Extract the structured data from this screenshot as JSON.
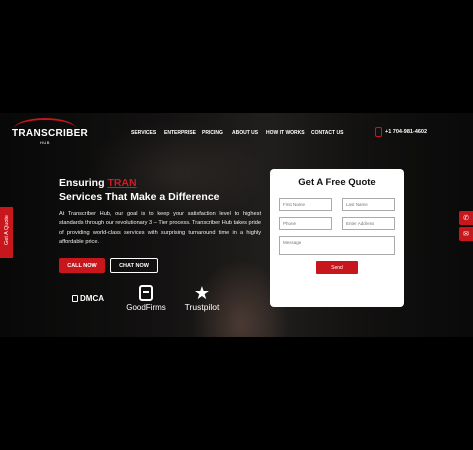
{
  "brand": {
    "name": "TRANSCRIBER",
    "sub": "HUB"
  },
  "nav": {
    "items": [
      "SERVICES",
      "ENTERPRISE",
      "PRICING",
      "ABOUT US",
      "HOW IT WORKS",
      "CONTACT US"
    ],
    "phone": "+1 704-981-4602"
  },
  "hero": {
    "title_prefix": "Ensuring",
    "title_accent": "TRAN",
    "title_line2": "Services That Make a Difference",
    "paragraph": "At Transcriber Hub, our goal is to keep your satisfaction level to highest standards through our revolutionary 3 – Tier process. Transcriber Hub takes pride of providing world-class services with surprising turnaround time in a highly affordable price.",
    "call_button": "CALL NOW",
    "chat_button": "CHAT NOW"
  },
  "badges": {
    "dmca": "DMCA",
    "goodfirms": "GoodFirms",
    "trustpilot": "Trustpilot"
  },
  "side_tab": {
    "label": "Get A Quote"
  },
  "form": {
    "title": "Get A Free Quote",
    "first_name_placeholder": "First Name",
    "last_name_placeholder": "Last Name",
    "phone_placeholder": "Phone",
    "email_placeholder": "Enter Address",
    "message_placeholder": "Message",
    "send_label": "Send"
  },
  "colors": {
    "accent": "#c8161d",
    "background": "#000000",
    "form_bg": "#ffffff"
  },
  "icons": [
    "phone-icon",
    "lock-icon",
    "goodfirms-icon",
    "star-icon",
    "whatsapp-icon",
    "chat-icon"
  ]
}
